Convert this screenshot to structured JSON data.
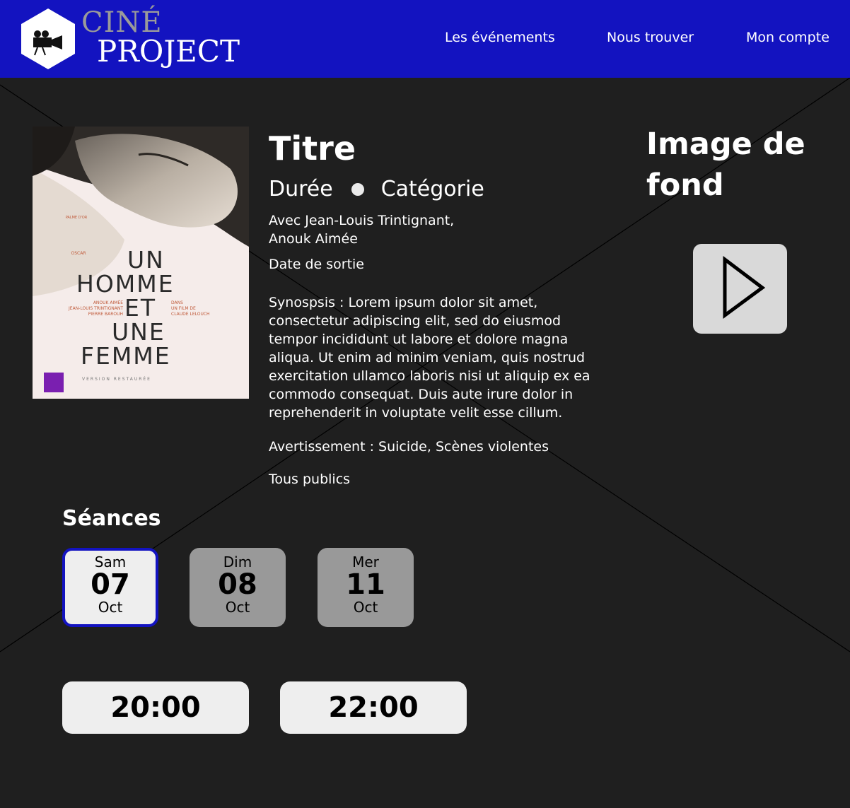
{
  "brand": {
    "line1": "CINÉ",
    "line2": "PROJECT",
    "icon": "film-camera-icon"
  },
  "nav": [
    {
      "label": "Les événements"
    },
    {
      "label": "Nous trouver"
    },
    {
      "label": "Mon compte"
    }
  ],
  "movie": {
    "title": "Titre",
    "duration": "Durée",
    "category": "Catégorie",
    "cast_line1": "Avec Jean-Louis Trintignant,",
    "cast_line2": "Anouk Aimée",
    "release": "Date de sortie",
    "synopsis_lines": [
      "Synospsis : Lorem ipsum dolor sit amet,",
      "consectetur adipiscing elit, sed do eiusmod",
      "tempor incididunt ut labore et dolore magna",
      "aliqua. Ut enim ad minim veniam, quis nostrud",
      "exercitation ullamco laboris nisi ut aliquip ex ea",
      "commodo consequat. Duis aute irure dolor in",
      "reprehenderit in voluptate velit esse cillum."
    ],
    "warning": "Avertissement : Suicide, Scènes violentes",
    "rating": "Tous publics"
  },
  "poster": {
    "palme": "PALME D'OR",
    "oscar": "OSCAR",
    "title_lines": [
      "UN",
      "HOMME",
      "ET",
      "UNE",
      "FEMME"
    ],
    "actor1": "ANOUK AIMÉE",
    "actor2": "JEAN-LOUIS TRINTIGNANT",
    "actor3": "PIERRE BAROUH",
    "dans": "DANS",
    "film_de": "UN FILM DE",
    "director": "CLAUDE LELOUCH",
    "version": "VERSION RESTAURÉE"
  },
  "background_label": {
    "line1": "Image de",
    "line2": "fond"
  },
  "play_icon": "play-icon",
  "seances": {
    "heading": "Séances",
    "dates": [
      {
        "day": "Sam",
        "num": "07",
        "month": "Oct",
        "selected": true
      },
      {
        "day": "Dim",
        "num": "08",
        "month": "Oct",
        "selected": false
      },
      {
        "day": "Mer",
        "num": "11",
        "month": "Oct",
        "selected": false
      }
    ],
    "times": [
      "20:00",
      "22:00"
    ]
  },
  "colors": {
    "header_bg": "#1313c0",
    "page_bg": "#1f1f1f",
    "selected_border": "#1313c0",
    "card_inactive": "#999999",
    "card_active": "#eeeeee"
  }
}
